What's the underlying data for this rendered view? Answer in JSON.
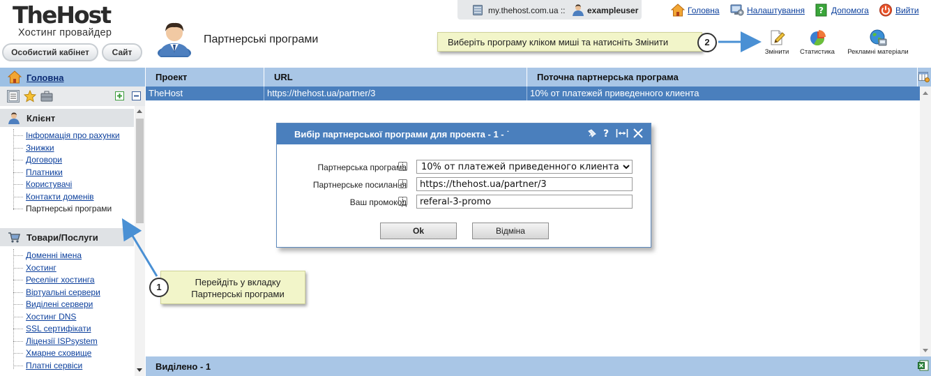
{
  "logo": {
    "main": "TheHost",
    "sub": "Хостинг провайдер"
  },
  "header_buttons": {
    "cabinet": "Особистий кабінет",
    "site": "Сайт"
  },
  "page_title": "Партнерські програми",
  "topbar": {
    "host": "my.thehost.com.ua ::",
    "username": "exampleuser"
  },
  "top_links": [
    {
      "label": "Головна",
      "icon": "home-icon"
    },
    {
      "label": "Налаштування",
      "icon": "settings-icon"
    },
    {
      "label": "Допомога",
      "icon": "help-icon"
    },
    {
      "label": "Вийти",
      "icon": "power-icon"
    }
  ],
  "toolbar": [
    {
      "label": "Змінити",
      "icon": "edit-icon"
    },
    {
      "label": "Статистика",
      "icon": "pie-chart-icon"
    },
    {
      "label": "Рекламні матеріали",
      "icon": "globe-icon"
    }
  ],
  "callouts": {
    "two": {
      "number": "2",
      "text": "Виберіть програму кліком миші та натисніть Змінити"
    },
    "one": {
      "number": "1",
      "line1": "Перейдіть у вкладку",
      "line2": "Партнерські програми"
    }
  },
  "nav": {
    "home": "Головна",
    "sections": [
      {
        "title": "Клієнт",
        "icon": "client-icon",
        "items": [
          "Інформація про рахунки",
          "Знижки",
          "Договори",
          "Платники",
          "Користувачі",
          "Контакти доменів",
          "Партнерські програми"
        ],
        "active_index": 6
      },
      {
        "title": "Товари/Послуги",
        "icon": "cart-icon",
        "items": [
          "Доменні імена",
          "Хостинг",
          "Реселінг хостинга",
          "Віртуальні сервери",
          "Виділені сервери",
          "Хостинг DNS",
          "SSL сертифікати",
          "Ліцензії ISPsystem",
          "Хмарне сховище",
          "Платні сервіси"
        ]
      }
    ]
  },
  "table": {
    "columns": [
      "Проект",
      "URL",
      "Поточна партнерська програма"
    ],
    "rows": [
      {
        "project": "TheHost",
        "url": "https://thehost.ua/partner/3",
        "program": "10% от платежей приведенного клиента"
      }
    ],
    "footer": "Виділено - 1"
  },
  "dialog": {
    "title": "Вибір партнерської програми для проекта - 1 - ˙",
    "fields": [
      {
        "label": "Партнерська програма",
        "value": "10% от платежей приведенного клиента",
        "type": "select"
      },
      {
        "label": "Партнерське посилання",
        "value": "https://thehost.ua/partner/3",
        "type": "text"
      },
      {
        "label": "Ваш промокод",
        "value": "referal-3-promo",
        "type": "text"
      }
    ],
    "ok": "Ok",
    "cancel": "Відміна"
  },
  "colors": {
    "header_blue": "#a9c6e6",
    "selected_row": "#4a7fbd",
    "link": "#0b3f9c",
    "callout_bg": "#f2f5c9"
  }
}
